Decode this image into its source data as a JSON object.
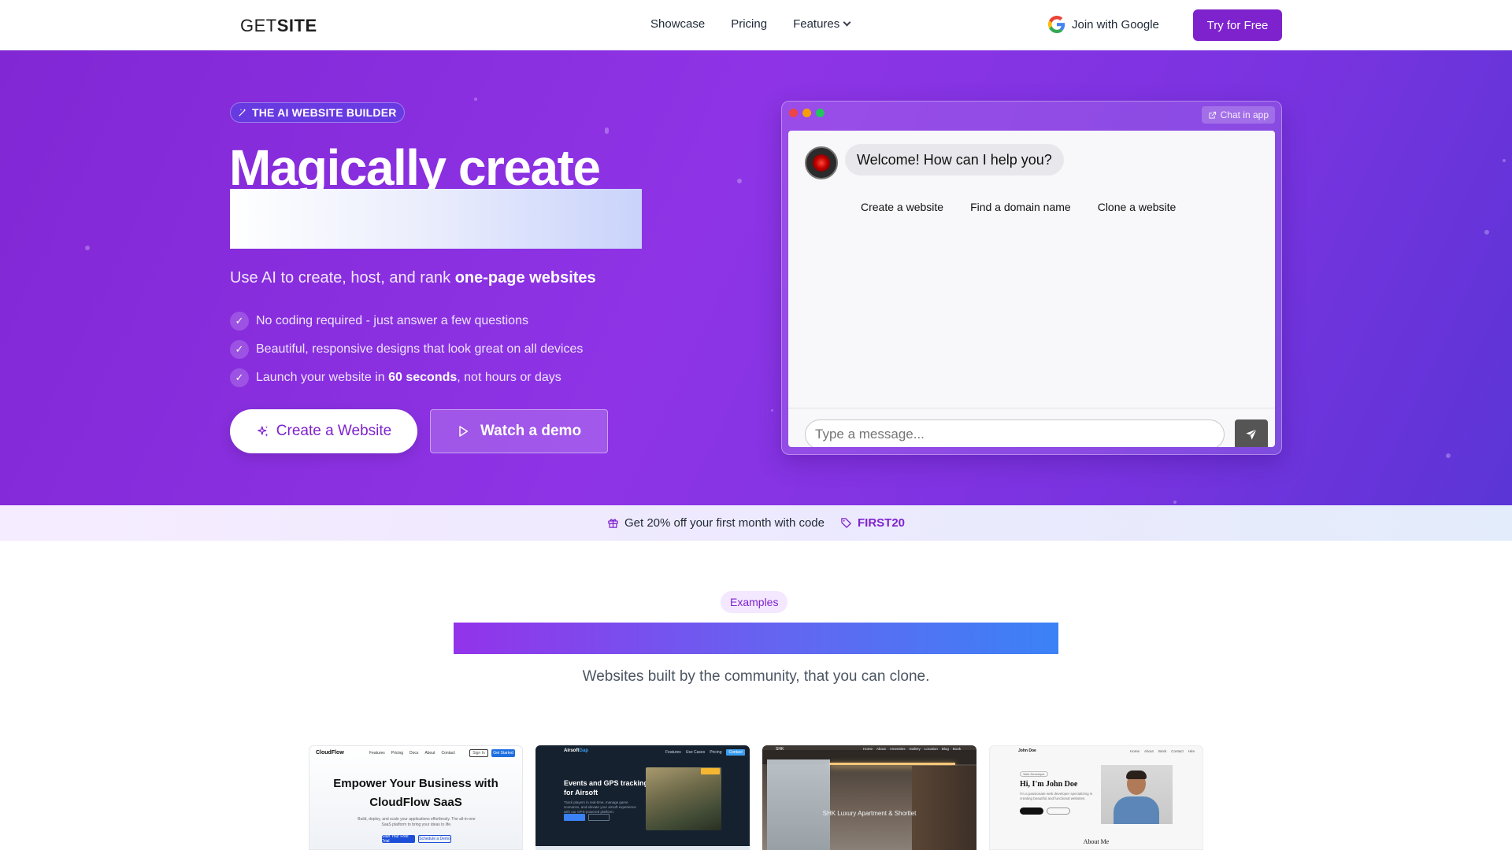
{
  "nav": {
    "logo_light": "GET",
    "logo_bold": "SITE",
    "links": [
      "Showcase",
      "Pricing",
      "Features"
    ],
    "google_label": "Join with Google",
    "try_label": "Try for Free"
  },
  "hero": {
    "badge": "THE AI WEBSITE BUILDER",
    "title": "Magically create",
    "subtitle_prefix": "Use AI to create, host, and rank ",
    "subtitle_bold": "one-page websites",
    "checks": [
      {
        "text": "No coding required - just answer a few questions"
      },
      {
        "text": "Beautiful, responsive designs that look great on all devices"
      },
      {
        "prefix": "Launch your website in ",
        "bold": "60 seconds",
        "suffix": ", not hours or days"
      }
    ],
    "create_button": "Create a Website",
    "demo_button": "Watch a demo"
  },
  "chat": {
    "chat_in_app": "Chat in app",
    "welcome": "Welcome! How can I help you?",
    "suggestions": [
      "Create a website",
      "Find a domain name",
      "Clone a website"
    ],
    "input_placeholder": "Type a message..."
  },
  "promo": {
    "text": "Get 20% off your first month with code",
    "code": "FIRST20"
  },
  "examples": {
    "badge": "Examples",
    "subtitle": "Websites built by the community, that you can clone.",
    "cards": [
      {
        "logo": "CloudFlow",
        "links": [
          "Features",
          "Pricing",
          "Docs",
          "About",
          "Contact"
        ],
        "btn1": "Sign In",
        "btn2": "Get Started",
        "title": "Empower Your Business with CloudFlow SaaS",
        "text": "Build, deploy, and scale your applications effortlessly. The all-in-one SaaS platform to bring your ideas to life.",
        "cta1": "Start Your Free Trial",
        "cta2": "Schedule a Demo"
      },
      {
        "logo_a": "Airsoft",
        "logo_b": "Gap",
        "links": [
          "Features",
          "Use Cases",
          "Pricing"
        ],
        "pill": "Contact",
        "title": "Events and GPS tracking for Airsoft",
        "text": "Track players in real-time, manage game scenarios, and elevate your airsoft experience with our GPS-powered platform."
      },
      {
        "logo": "SHK",
        "links": [
          "Home",
          "About",
          "Amenities",
          "Gallery",
          "Location",
          "Blog",
          "Book"
        ],
        "caption": "SHK Luxury Apartment & Shortlet"
      },
      {
        "logo": "John Doe",
        "links": [
          "Home",
          "About",
          "Work",
          "Contact",
          "Hire"
        ],
        "badge": "Web Developer",
        "title": "Hi, I'm John Doe",
        "text": "I'm a passionate web developer specializing in creating beautiful and functional websites.",
        "about": "About Me"
      }
    ]
  },
  "colors": {
    "brand": "#7e22ce",
    "hero_start": "#8127d4",
    "hero_end": "#5b35d6"
  },
  "icons": {
    "badge": "wand-sparkles-icon",
    "check": "check-icon",
    "create": "sparkles-icon",
    "demo": "play-icon",
    "chat_in_app": "external-link-icon",
    "send": "send-icon",
    "promo_gift": "gift-icon",
    "promo_tag": "tag-icon",
    "google": "google-icon",
    "features": "chevron-down-icon"
  }
}
